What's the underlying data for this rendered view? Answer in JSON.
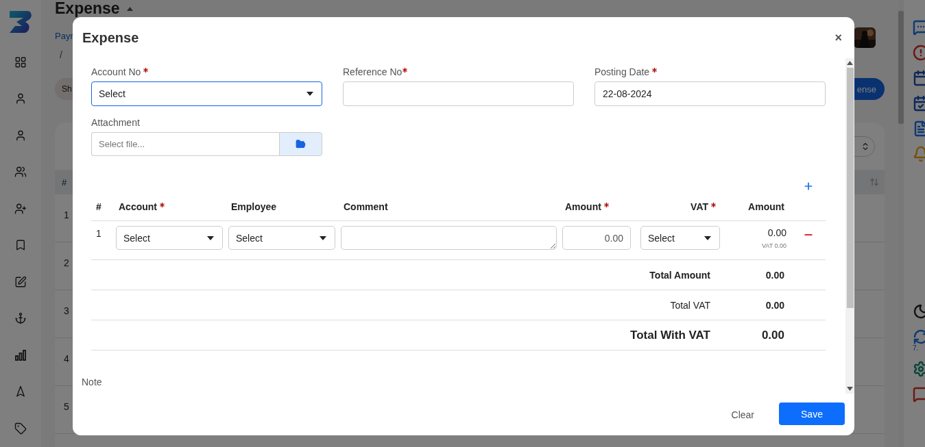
{
  "app": {
    "title": "Expense",
    "breadcrumb": "Payr",
    "breadcrumb_separator": "/",
    "chip": "Sh",
    "action_button": "ense",
    "table_header": "#",
    "row_numbers": [
      "1",
      "2",
      "3",
      "4",
      "5"
    ],
    "rail_badge": "7."
  },
  "modal": {
    "title": "Expense",
    "close": "×",
    "fields": [
      {
        "label": "Account No",
        "required": true,
        "kind": "select",
        "value": "Select",
        "focused": true
      },
      {
        "label": "Reference No",
        "required": true,
        "kind": "text",
        "focused": false
      },
      {
        "label": "Posting Date",
        "required": true,
        "kind": "text",
        "value": "22-08-2024",
        "focused": false
      }
    ],
    "attachment": {
      "label": "Attachment",
      "placeholder": "Select file..."
    },
    "lines": {
      "columns": [
        {
          "label": "#",
          "required": false
        },
        {
          "label": "Account",
          "required": true
        },
        {
          "label": "Employee",
          "required": false
        },
        {
          "label": "Comment",
          "required": false
        },
        {
          "label": "Amount",
          "required": true
        },
        {
          "label": "VAT",
          "required": true
        },
        {
          "label": "Amount",
          "required": false
        }
      ],
      "rows": [
        {
          "number": "1",
          "account": "Select",
          "employee": "Select",
          "amount": "0.00",
          "vat": "Select",
          "total": "0.00",
          "vat_note": "VAT 0.00"
        }
      ]
    },
    "totals": [
      {
        "label": "Total Amount",
        "value": "0.00",
        "kind": "bold"
      },
      {
        "label": "Total VAT",
        "value": "0.00",
        "kind": "normal"
      },
      {
        "label": "Total With VAT",
        "value": "0.00",
        "kind": "large"
      }
    ],
    "note_label": "Note",
    "buttons": {
      "clear": "Clear",
      "save": "Save"
    }
  }
}
